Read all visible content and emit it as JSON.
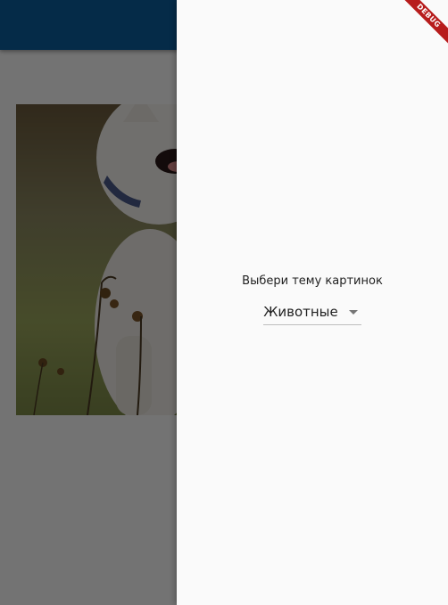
{
  "theme": {
    "app_bar_color": "#0d5e9e",
    "drawer_bg": "#fafafa",
    "page_bg": "#fafafa",
    "debug_color": "#b71c1c"
  },
  "app_bar": {
    "title": ""
  },
  "drawer": {
    "label": "Выбери тему картинок",
    "dropdown": {
      "selected": "Животные"
    }
  },
  "debug_banner": {
    "text": "DEBUG"
  },
  "image": {
    "icon": "dog-photo"
  }
}
